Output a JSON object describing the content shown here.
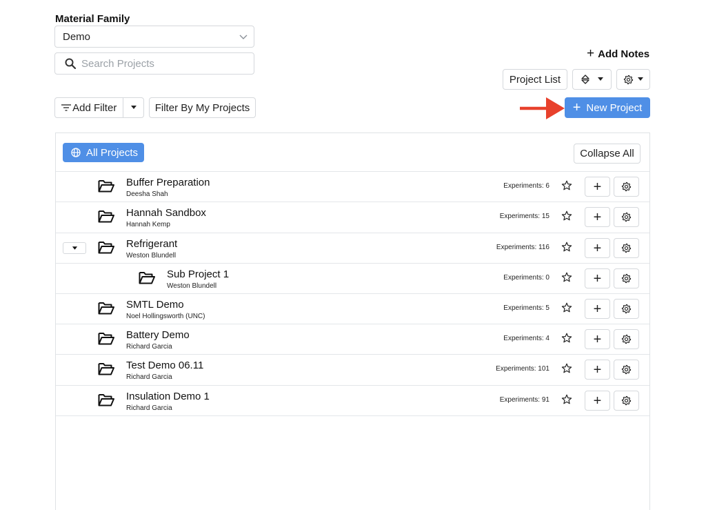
{
  "material_family": {
    "label": "Material Family",
    "selected": "Demo"
  },
  "search": {
    "placeholder": "Search Projects",
    "value": ""
  },
  "toolbar": {
    "add_notes": "Add Notes",
    "project_list": "Project List",
    "add_filter": "Add Filter",
    "filter_my": "Filter By My Projects",
    "new_project": "New Project"
  },
  "panel": {
    "all_projects": "All Projects",
    "collapse_all": "Collapse All"
  },
  "projects": [
    {
      "name": "Buffer Preparation",
      "owner": "Deesha Shah",
      "experiments": "Experiments: 6"
    },
    {
      "name": "Hannah Sandbox",
      "owner": "Hannah Kemp",
      "experiments": "Experiments: 15"
    },
    {
      "name": "Refrigerant",
      "owner": "Weston Blundell",
      "experiments": "Experiments: 116"
    },
    {
      "name": "Sub Project 1",
      "owner": "Weston Blundell",
      "experiments": "Experiments: 0"
    },
    {
      "name": "SMTL Demo",
      "owner": "Noel Hollingsworth (UNC)",
      "experiments": "Experiments: 5"
    },
    {
      "name": "Battery Demo",
      "owner": "Richard Garcia",
      "experiments": "Experiments: 4"
    },
    {
      "name": "Test Demo 06.11",
      "owner": "Richard Garcia",
      "experiments": "Experiments: 101"
    },
    {
      "name": "Insulation Demo 1",
      "owner": "Richard Garcia",
      "experiments": "Experiments: 91"
    }
  ],
  "colors": {
    "primary": "#4f8fe6",
    "annotation_arrow": "#e8412c"
  }
}
